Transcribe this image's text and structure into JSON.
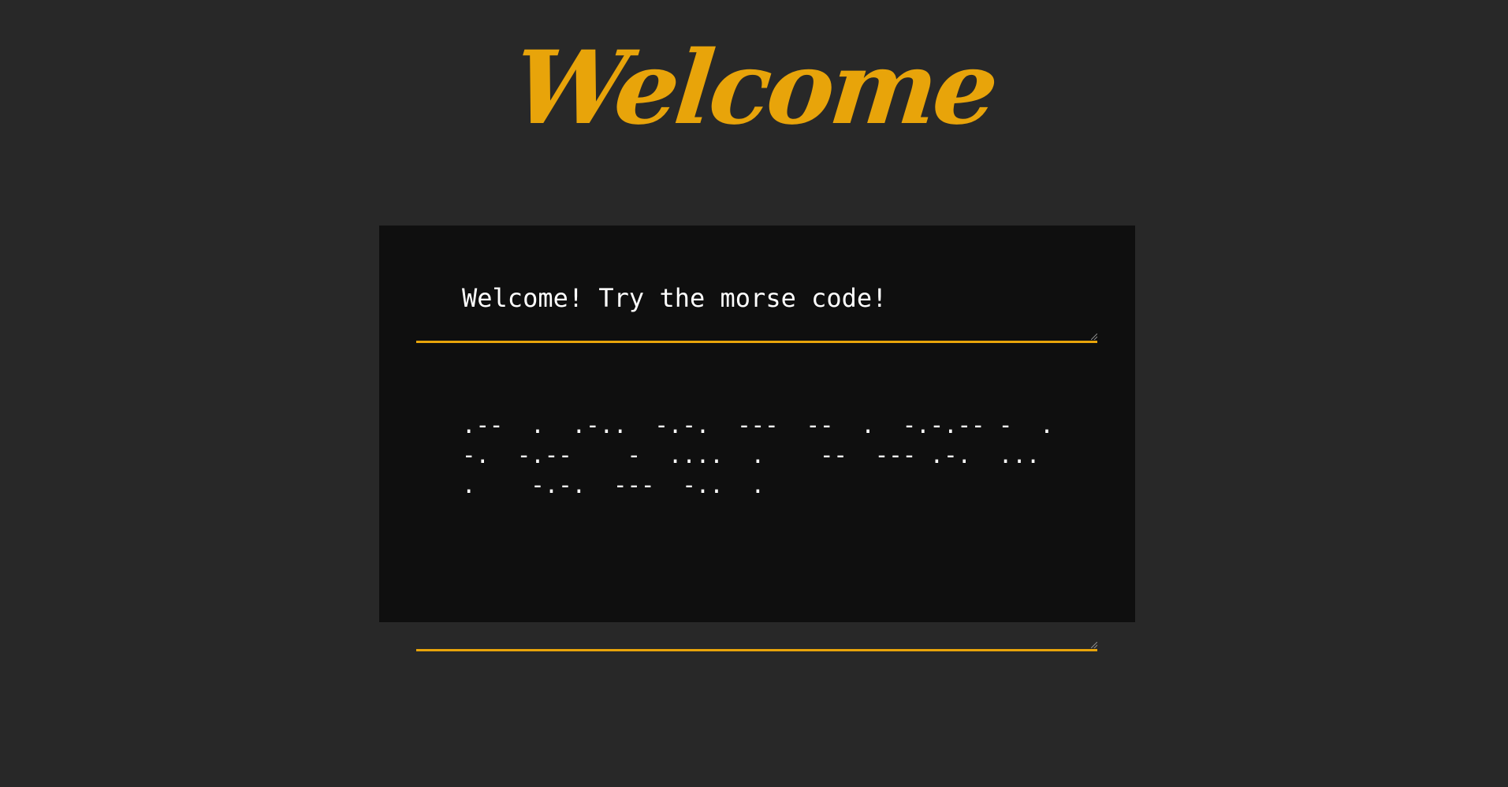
{
  "header": {
    "title": "Welcome"
  },
  "translator": {
    "input_text": "Welcome! Try the morse code!",
    "output_text": ".--  .  .-..  -.-.  ---  --  .  -.-.-- -  .-.  -.--    -  ....  .    --  --- .-.  ...  .    -.-.  ---  -..  ."
  },
  "colors": {
    "accent": "#e8a40a",
    "page_background": "#282828",
    "panel_background": "#0f0f0f",
    "text": "#ffffff"
  }
}
